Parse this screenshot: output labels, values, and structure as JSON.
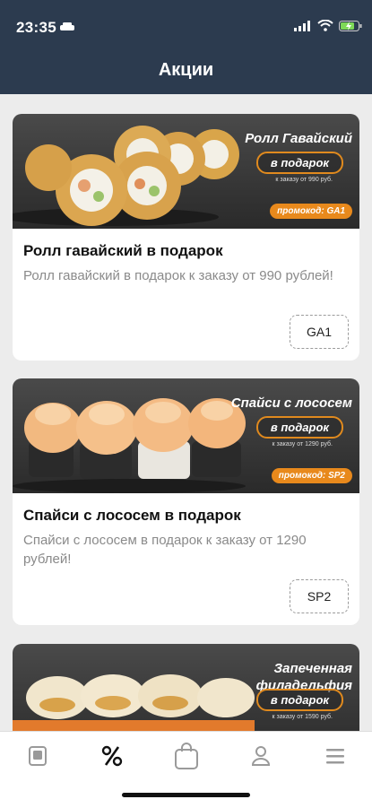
{
  "status_bar": {
    "time": "23:35"
  },
  "header": {
    "title": "Акции"
  },
  "promotions": [
    {
      "banner_title": "Ролл Гавайский",
      "banner_pill": "в подарок",
      "banner_note": "к заказу от 990 руб.",
      "banner_promo": "промокод: GA1",
      "title": "Ролл гавайский в подарок",
      "description": "Ролл гавайский в подарок к заказу от 990 рублей!",
      "code": "GA1"
    },
    {
      "banner_title": "Спайси с лососем",
      "banner_pill": "в подарок",
      "banner_note": "к заказу от 1290 руб.",
      "banner_promo": "промокод: SP2",
      "title": "Спайси с лососем в подарок",
      "description": "Спайси с лососем в подарок к заказу от 1290 рублей!",
      "code": "SP2"
    },
    {
      "banner_title": "Запеченная филадельфия",
      "banner_pill": "в подарок",
      "banner_note": "к заказу от 1590 руб."
    }
  ],
  "colors": {
    "header_bg": "#2c3b4f",
    "accent": "#e8891c",
    "active_tab": "#111111",
    "inactive_tab": "#9a9a9a"
  },
  "tabbar": {
    "tabs": [
      {
        "icon": "menu-card-icon",
        "active": false
      },
      {
        "icon": "percent-icon",
        "active": true
      },
      {
        "icon": "cart-bag-icon",
        "active": false
      },
      {
        "icon": "profile-icon",
        "active": false
      },
      {
        "icon": "hamburger-menu-icon",
        "active": false
      }
    ]
  }
}
